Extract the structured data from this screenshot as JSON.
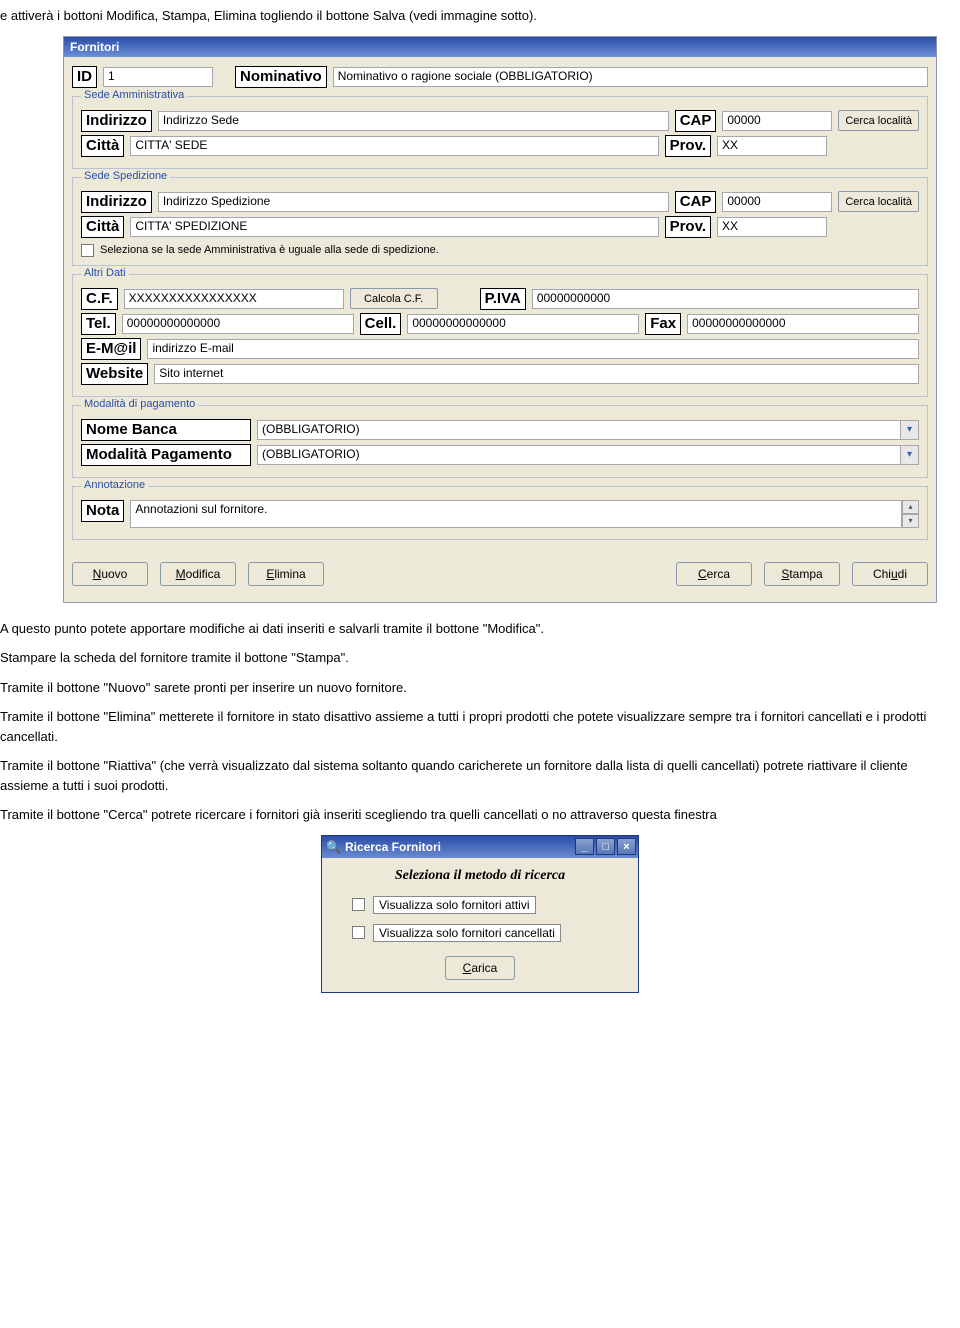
{
  "intro_text": "e attiverà i bottoni Modifica, Stampa, Elimina togliendo il bottone Salva (vedi immagine sotto).",
  "form": {
    "title": "Fornitori",
    "id_label": "ID",
    "id_value": "1",
    "nominativo_label": "Nominativo",
    "nominativo_value": "Nominativo o ragione sociale (OBBLIGATORIO)",
    "sede_amm": {
      "title": "Sede Amministrativa",
      "indirizzo_label": "Indirizzo",
      "indirizzo_value": "Indirizzo Sede",
      "cap_label": "CAP",
      "cap_value": "00000",
      "cerca_btn": "Cerca località",
      "citta_label": "Città",
      "citta_value": "CITTA' SEDE",
      "prov_label": "Prov.",
      "prov_value": "XX"
    },
    "sede_sped": {
      "title": "Sede Spedizione",
      "indirizzo_label": "Indirizzo",
      "indirizzo_value": "Indirizzo Spedizione",
      "cap_label": "CAP",
      "cap_value": "00000",
      "cerca_btn": "Cerca località",
      "citta_label": "Città",
      "citta_value": "CITTA' SPEDIZIONE",
      "prov_label": "Prov.",
      "prov_value": "XX",
      "checkbox_text": "Seleziona se la sede Amministrativa è uguale alla sede di spedizione."
    },
    "altri": {
      "title": "Altri Dati",
      "cf_label": "C.F.",
      "cf_value": "XXXXXXXXXXXXXXXX",
      "calc_cf_btn": "Calcola C.F.",
      "piva_label": "P.IVA",
      "piva_value": "00000000000",
      "tel_label": "Tel.",
      "tel_value": "00000000000000",
      "cell_label": "Cell.",
      "cell_value": "00000000000000",
      "fax_label": "Fax",
      "fax_value": "00000000000000",
      "email_label": "E-M@il",
      "email_value": "indirizzo E-mail",
      "website_label": "Website",
      "website_value": "Sito internet"
    },
    "pagamento": {
      "title": "Modalità di pagamento",
      "banca_label": "Nome Banca",
      "banca_value": "(OBBLIGATORIO)",
      "modalita_label": "Modalità Pagamento",
      "modalita_value": "(OBBLIGATORIO)"
    },
    "annotazione": {
      "title": "Annotazione",
      "nota_label": "Nota",
      "nota_value": "Annotazioni sul fornitore."
    },
    "buttons": {
      "nuovo": "Nuovo",
      "modifica": "Modifica",
      "elimina": "Elimina",
      "cerca": "Cerca",
      "stampa": "Stampa",
      "chiudi": "Chiudi"
    }
  },
  "paragraphs": {
    "p1": "A questo punto potete apportare modifiche ai dati inseriti e salvarli tramite il bottone \"Modifica\".",
    "p2": "Stampare la scheda del fornitore tramite il bottone \"Stampa\".",
    "p3": "Tramite il bottone \"Nuovo\" sarete pronti per inserire un nuovo fornitore.",
    "p4": "Tramite il bottone \"Elimina\" metterete il fornitore in stato disattivo assieme a tutti i propri prodotti che potete visualizzare sempre tra i fornitori cancellati e i prodotti cancellati.",
    "p5": "Tramite il bottone \"Riattiva\" (che verrà visualizzato dal sistema soltanto quando caricherete un fornitore dalla lista di quelli cancellati) potrete riattivare il cliente assieme a tutti i suoi prodotti.",
    "p6": "Tramite il bottone \"Cerca\" potrete ricercare i fornitori già inseriti scegliendo tra quelli cancellati o no attraverso questa finestra"
  },
  "search_window": {
    "title": "Ricerca Fornitori",
    "heading": "Seleziona il metodo di ricerca",
    "opt1": "Visualizza solo fornitori attivi",
    "opt2": "Visualizza solo fornitori cancellati",
    "carica_btn": "Carica"
  }
}
